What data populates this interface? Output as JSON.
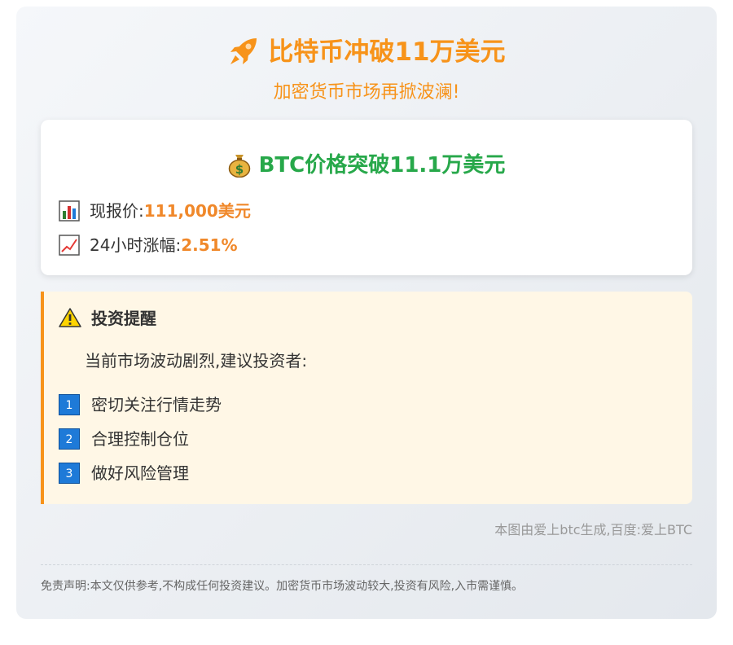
{
  "header": {
    "title": "比特币冲破11万美元",
    "subtitle": "加密货币市场再掀波澜!",
    "title_icon": "rocket-icon"
  },
  "price_card": {
    "title": "BTC价格突破11.1万美元",
    "title_icon": "money-bag-icon",
    "current_price_label": "现报价:",
    "current_price_value": "111,000美元",
    "current_price_icon": "bar-chart-icon",
    "change_label": "24小时涨幅:",
    "change_value": "2.51%",
    "change_icon": "chart-increasing-icon"
  },
  "tips": {
    "title": "投资提醒",
    "title_icon": "warning-icon",
    "intro": "当前市场波动剧烈,建议投资者:",
    "items": [
      {
        "number": "1",
        "text": "密切关注行情走势"
      },
      {
        "number": "2",
        "text": "合理控制仓位"
      },
      {
        "number": "3",
        "text": "做好风险管理"
      }
    ]
  },
  "credit": "本图由爱上btc生成,百度:爱上BTC",
  "disclaimer": "免责声明:本文仅供参考,不构成任何投资建议。加密货币市场波动较大,投资有风险,入市需谨慎。",
  "colors": {
    "accent_orange": "#f7931a",
    "accent_green": "#27a84a",
    "badge_blue": "#1e7ad8",
    "tips_background": "#fff7e6"
  }
}
